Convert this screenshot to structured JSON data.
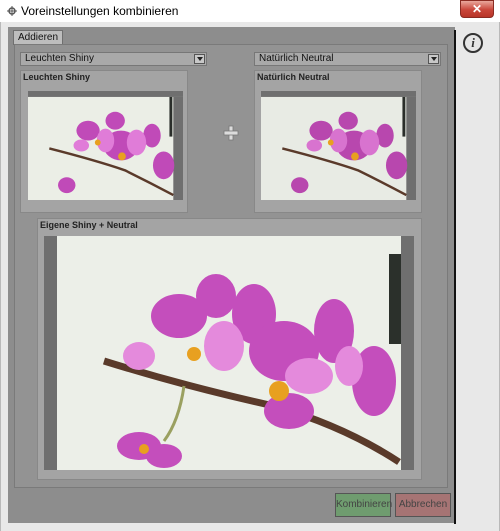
{
  "window": {
    "title": "Voreinstellungen kombinieren",
    "close_label": "✕"
  },
  "tabs": [
    {
      "label": "Addieren"
    }
  ],
  "left_preset": {
    "selected": "Leuchten Shiny",
    "card_title": "Leuchten Shiny"
  },
  "right_preset": {
    "selected": "Natürlich Neutral",
    "card_title": "Natürlich Neutral"
  },
  "result": {
    "card_title": "Eigene Shiny + Neutral"
  },
  "combine_symbol": "plus-icon",
  "info_icon": "i",
  "buttons": {
    "combine": "Kombinieren",
    "cancel": "Abbrechen"
  },
  "colors": {
    "combine": "#6f9c6f",
    "cancel": "#a67474",
    "workspace": "#8d8d8d"
  }
}
